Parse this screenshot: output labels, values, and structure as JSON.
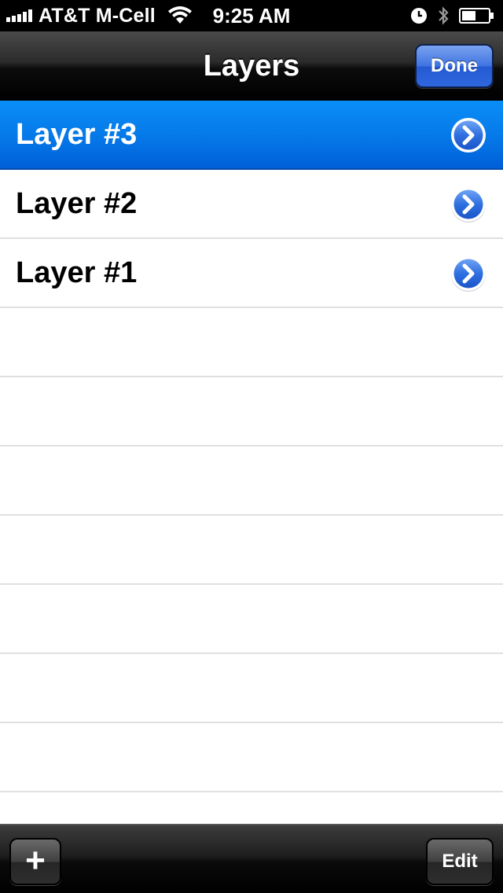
{
  "status_bar": {
    "carrier": "AT&T M-Cell",
    "time": "9:25 AM"
  },
  "nav": {
    "title": "Layers",
    "done_label": "Done"
  },
  "layers": [
    {
      "label": "Layer #3",
      "selected": true
    },
    {
      "label": "Layer #2",
      "selected": false
    },
    {
      "label": "Layer #1",
      "selected": false
    }
  ],
  "toolbar": {
    "add_label": "+",
    "edit_label": "Edit"
  },
  "colors": {
    "selection": "#0578e8",
    "done_button": "#2f67dd"
  },
  "icons": {
    "signal": "signal-bars-icon",
    "wifi": "wifi-icon",
    "alarm": "alarm-clock-icon",
    "bluetooth": "bluetooth-icon",
    "battery": "battery-icon",
    "disclosure": "detail-disclosure-icon"
  }
}
